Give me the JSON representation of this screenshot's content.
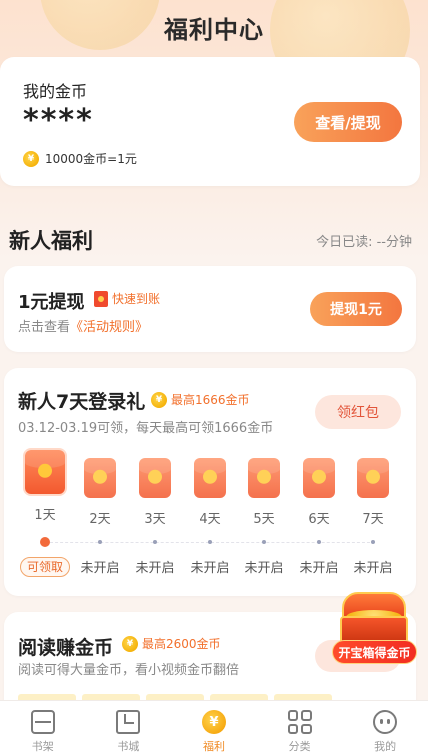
{
  "page": {
    "title": "福利中心"
  },
  "coins": {
    "label": "我的金币",
    "value": "****",
    "rate_icon": "coin-icon",
    "rate": "10000金币=1元",
    "withdraw_label": "查看/提现"
  },
  "newbie": {
    "section_title": "新人福利",
    "read_today": "今日已读: --分钟"
  },
  "one_yuan": {
    "title": "1元提现",
    "tag": "快速到账",
    "desc_prefix": "点击查看",
    "rules_link": "《活动规则》",
    "button": "提现1元"
  },
  "login_gift": {
    "title": "新人7天登录礼",
    "max_tag": "最高1666金币",
    "desc": "03.12-03.19可领，每天最高可领1666金币",
    "button": "领红包",
    "days": [
      {
        "label": "1天",
        "status": "可领取"
      },
      {
        "label": "2天",
        "status": "未开启"
      },
      {
        "label": "3天",
        "status": "未开启"
      },
      {
        "label": "4天",
        "status": "未开启"
      },
      {
        "label": "5天",
        "status": "未开启"
      },
      {
        "label": "6天",
        "status": "未开启"
      },
      {
        "label": "7天",
        "status": "未开启"
      }
    ]
  },
  "read_earn": {
    "title": "阅读赚金币",
    "max_tag": "最高2600金币",
    "desc": "阅读可得大量金币，看小视频金币翻倍"
  },
  "chest": {
    "label": "开宝箱得金币"
  },
  "nav": {
    "items": [
      {
        "label": "书架",
        "icon": "bookshelf-icon"
      },
      {
        "label": "书城",
        "icon": "bookstore-icon"
      },
      {
        "label": "福利",
        "icon": "welfare-coin-icon",
        "active": true,
        "glyph": "¥"
      },
      {
        "label": "分类",
        "icon": "category-icon"
      },
      {
        "label": "我的",
        "icon": "profile-icon"
      }
    ]
  },
  "colors": {
    "accent": "#f3763f",
    "gold": "#f5b30c",
    "red_packet": "#f3592f",
    "nav_active": "#f08a23"
  }
}
